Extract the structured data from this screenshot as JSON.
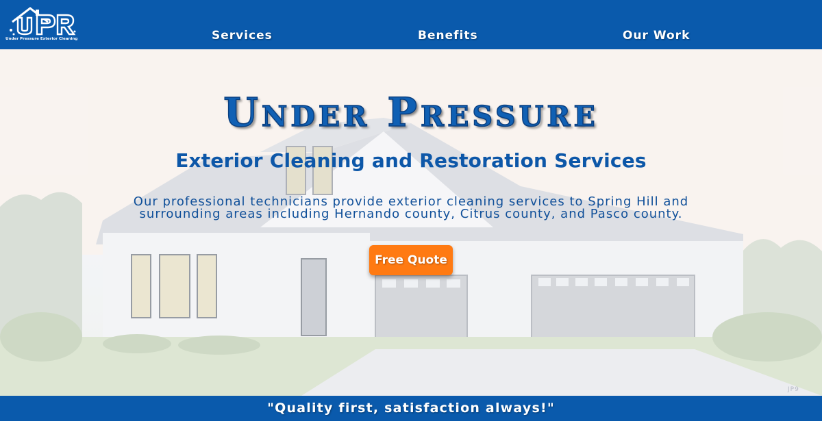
{
  "header": {
    "logo": {
      "monogram": "UP",
      "caption": "Under Pressure Exterior Cleaning",
      "icon": "house-roof-icon"
    },
    "nav": [
      {
        "label": "Services"
      },
      {
        "label": "Benefits"
      },
      {
        "label": "Our Work"
      }
    ]
  },
  "hero": {
    "title": "Under Pressure",
    "subtitle": "Exterior Cleaning and Restoration Services",
    "description": "Our professional technicians provide exterior cleaning services to Spring Hill and surrounding areas including Hernando county, Citrus county, and Pasco county.",
    "cta_label": "Free Quote",
    "background": "photo of white house with two garage doors at dusk",
    "watermark": "JP9"
  },
  "footer": {
    "tagline": "\"Quality first, satisfaction always!\""
  },
  "colors": {
    "brand_blue": "#0a5aac",
    "title_blue": "#1060b4",
    "cta_orange": "#ff7a12",
    "text_white": "#ffffff"
  }
}
